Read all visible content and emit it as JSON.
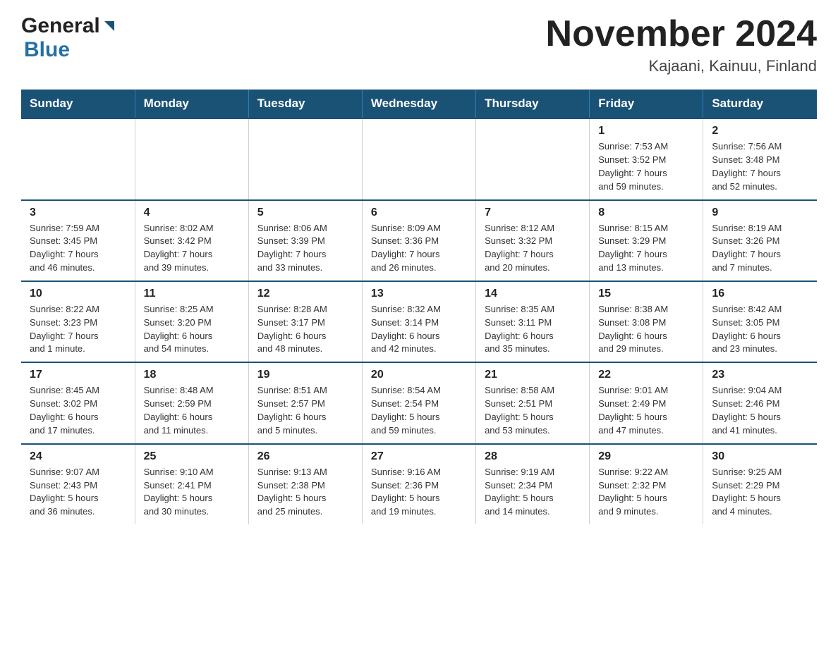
{
  "header": {
    "logo_general": "General",
    "logo_blue": "Blue",
    "month_title": "November 2024",
    "location": "Kajaani, Kainuu, Finland"
  },
  "weekdays": [
    "Sunday",
    "Monday",
    "Tuesday",
    "Wednesday",
    "Thursday",
    "Friday",
    "Saturday"
  ],
  "weeks": [
    {
      "days": [
        {
          "num": "",
          "info": "",
          "empty": true
        },
        {
          "num": "",
          "info": "",
          "empty": true
        },
        {
          "num": "",
          "info": "",
          "empty": true
        },
        {
          "num": "",
          "info": "",
          "empty": true
        },
        {
          "num": "",
          "info": "",
          "empty": true
        },
        {
          "num": "1",
          "info": "Sunrise: 7:53 AM\nSunset: 3:52 PM\nDaylight: 7 hours\nand 59 minutes.",
          "empty": false
        },
        {
          "num": "2",
          "info": "Sunrise: 7:56 AM\nSunset: 3:48 PM\nDaylight: 7 hours\nand 52 minutes.",
          "empty": false
        }
      ]
    },
    {
      "days": [
        {
          "num": "3",
          "info": "Sunrise: 7:59 AM\nSunset: 3:45 PM\nDaylight: 7 hours\nand 46 minutes.",
          "empty": false
        },
        {
          "num": "4",
          "info": "Sunrise: 8:02 AM\nSunset: 3:42 PM\nDaylight: 7 hours\nand 39 minutes.",
          "empty": false
        },
        {
          "num": "5",
          "info": "Sunrise: 8:06 AM\nSunset: 3:39 PM\nDaylight: 7 hours\nand 33 minutes.",
          "empty": false
        },
        {
          "num": "6",
          "info": "Sunrise: 8:09 AM\nSunset: 3:36 PM\nDaylight: 7 hours\nand 26 minutes.",
          "empty": false
        },
        {
          "num": "7",
          "info": "Sunrise: 8:12 AM\nSunset: 3:32 PM\nDaylight: 7 hours\nand 20 minutes.",
          "empty": false
        },
        {
          "num": "8",
          "info": "Sunrise: 8:15 AM\nSunset: 3:29 PM\nDaylight: 7 hours\nand 13 minutes.",
          "empty": false
        },
        {
          "num": "9",
          "info": "Sunrise: 8:19 AM\nSunset: 3:26 PM\nDaylight: 7 hours\nand 7 minutes.",
          "empty": false
        }
      ]
    },
    {
      "days": [
        {
          "num": "10",
          "info": "Sunrise: 8:22 AM\nSunset: 3:23 PM\nDaylight: 7 hours\nand 1 minute.",
          "empty": false
        },
        {
          "num": "11",
          "info": "Sunrise: 8:25 AM\nSunset: 3:20 PM\nDaylight: 6 hours\nand 54 minutes.",
          "empty": false
        },
        {
          "num": "12",
          "info": "Sunrise: 8:28 AM\nSunset: 3:17 PM\nDaylight: 6 hours\nand 48 minutes.",
          "empty": false
        },
        {
          "num": "13",
          "info": "Sunrise: 8:32 AM\nSunset: 3:14 PM\nDaylight: 6 hours\nand 42 minutes.",
          "empty": false
        },
        {
          "num": "14",
          "info": "Sunrise: 8:35 AM\nSunset: 3:11 PM\nDaylight: 6 hours\nand 35 minutes.",
          "empty": false
        },
        {
          "num": "15",
          "info": "Sunrise: 8:38 AM\nSunset: 3:08 PM\nDaylight: 6 hours\nand 29 minutes.",
          "empty": false
        },
        {
          "num": "16",
          "info": "Sunrise: 8:42 AM\nSunset: 3:05 PM\nDaylight: 6 hours\nand 23 minutes.",
          "empty": false
        }
      ]
    },
    {
      "days": [
        {
          "num": "17",
          "info": "Sunrise: 8:45 AM\nSunset: 3:02 PM\nDaylight: 6 hours\nand 17 minutes.",
          "empty": false
        },
        {
          "num": "18",
          "info": "Sunrise: 8:48 AM\nSunset: 2:59 PM\nDaylight: 6 hours\nand 11 minutes.",
          "empty": false
        },
        {
          "num": "19",
          "info": "Sunrise: 8:51 AM\nSunset: 2:57 PM\nDaylight: 6 hours\nand 5 minutes.",
          "empty": false
        },
        {
          "num": "20",
          "info": "Sunrise: 8:54 AM\nSunset: 2:54 PM\nDaylight: 5 hours\nand 59 minutes.",
          "empty": false
        },
        {
          "num": "21",
          "info": "Sunrise: 8:58 AM\nSunset: 2:51 PM\nDaylight: 5 hours\nand 53 minutes.",
          "empty": false
        },
        {
          "num": "22",
          "info": "Sunrise: 9:01 AM\nSunset: 2:49 PM\nDaylight: 5 hours\nand 47 minutes.",
          "empty": false
        },
        {
          "num": "23",
          "info": "Sunrise: 9:04 AM\nSunset: 2:46 PM\nDaylight: 5 hours\nand 41 minutes.",
          "empty": false
        }
      ]
    },
    {
      "days": [
        {
          "num": "24",
          "info": "Sunrise: 9:07 AM\nSunset: 2:43 PM\nDaylight: 5 hours\nand 36 minutes.",
          "empty": false
        },
        {
          "num": "25",
          "info": "Sunrise: 9:10 AM\nSunset: 2:41 PM\nDaylight: 5 hours\nand 30 minutes.",
          "empty": false
        },
        {
          "num": "26",
          "info": "Sunrise: 9:13 AM\nSunset: 2:38 PM\nDaylight: 5 hours\nand 25 minutes.",
          "empty": false
        },
        {
          "num": "27",
          "info": "Sunrise: 9:16 AM\nSunset: 2:36 PM\nDaylight: 5 hours\nand 19 minutes.",
          "empty": false
        },
        {
          "num": "28",
          "info": "Sunrise: 9:19 AM\nSunset: 2:34 PM\nDaylight: 5 hours\nand 14 minutes.",
          "empty": false
        },
        {
          "num": "29",
          "info": "Sunrise: 9:22 AM\nSunset: 2:32 PM\nDaylight: 5 hours\nand 9 minutes.",
          "empty": false
        },
        {
          "num": "30",
          "info": "Sunrise: 9:25 AM\nSunset: 2:29 PM\nDaylight: 5 hours\nand 4 minutes.",
          "empty": false
        }
      ]
    }
  ]
}
